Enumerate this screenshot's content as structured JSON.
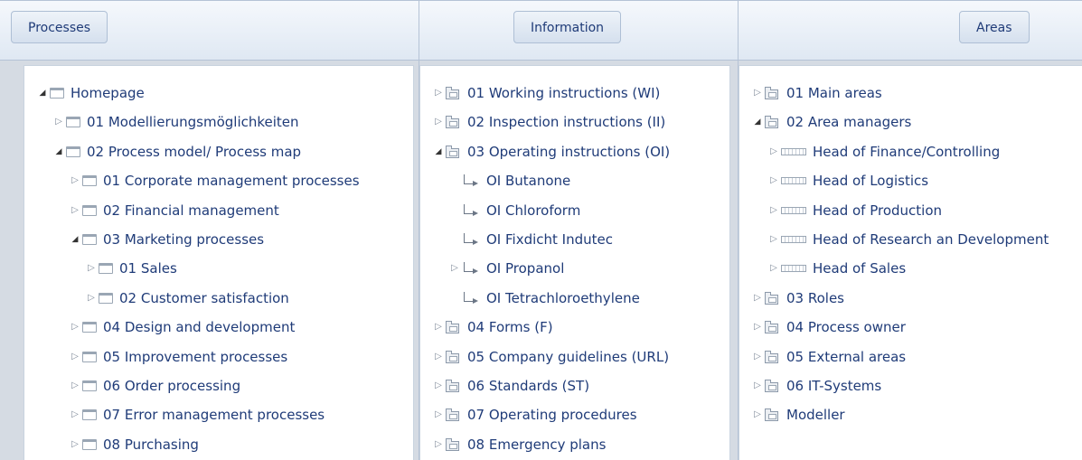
{
  "headers": {
    "processes": "Processes",
    "information": "Information",
    "areas": "Areas"
  },
  "processes_tree": [
    {
      "label": "Homepage",
      "toggle": "open",
      "level": 0
    },
    {
      "label": "01 Modellierungsmöglichkeiten",
      "toggle": "closed",
      "level": 1
    },
    {
      "label": "02 Process model/ Process map",
      "toggle": "open",
      "level": 1
    },
    {
      "label": "01 Corporate management processes",
      "toggle": "closed",
      "level": 2
    },
    {
      "label": "02 Financial management",
      "toggle": "closed",
      "level": 2
    },
    {
      "label": "03 Marketing processes",
      "toggle": "open",
      "level": 2
    },
    {
      "label": "01 Sales",
      "toggle": "closed",
      "level": 3
    },
    {
      "label": "02 Customer satisfaction",
      "toggle": "closed",
      "level": 3
    },
    {
      "label": "04 Design and development",
      "toggle": "closed",
      "level": 2
    },
    {
      "label": "05 Improvement processes",
      "toggle": "closed",
      "level": 2
    },
    {
      "label": "06 Order processing",
      "toggle": "closed",
      "level": 2
    },
    {
      "label": "07 Error management processes",
      "toggle": "closed",
      "level": 2
    },
    {
      "label": "08 Purchasing",
      "toggle": "closed",
      "level": 2
    }
  ],
  "information_tree": [
    {
      "label": "01 Working instructions (WI)",
      "toggle": "closed",
      "icon": "folder"
    },
    {
      "label": "02 Inspection instructions (II)",
      "toggle": "closed",
      "icon": "folder"
    },
    {
      "label": "03 Operating instructions (OI)",
      "toggle": "open",
      "icon": "folder"
    },
    {
      "label": "OI Butanone",
      "toggle": "none",
      "icon": "link"
    },
    {
      "label": "OI Chloroform",
      "toggle": "none",
      "icon": "link"
    },
    {
      "label": "OI Fixdicht Indutec",
      "toggle": "none",
      "icon": "link"
    },
    {
      "label": "OI Propanol",
      "toggle": "closed",
      "icon": "link"
    },
    {
      "label": "OI Tetrachloroethylene",
      "toggle": "none",
      "icon": "link"
    },
    {
      "label": "04 Forms (F)",
      "toggle": "closed",
      "icon": "folder"
    },
    {
      "label": "05 Company guidelines (URL)",
      "toggle": "closed",
      "icon": "folder"
    },
    {
      "label": "06 Standards (ST)",
      "toggle": "closed",
      "icon": "folder"
    },
    {
      "label": "07 Operating procedures",
      "toggle": "closed",
      "icon": "folder"
    },
    {
      "label": "08 Emergency plans",
      "toggle": "closed",
      "icon": "folder"
    }
  ],
  "areas_tree": [
    {
      "label": "01 Main areas",
      "toggle": "closed",
      "icon": "folder"
    },
    {
      "label": "02 Area managers",
      "toggle": "open",
      "icon": "folder"
    },
    {
      "label": "Head of Finance/Controlling",
      "toggle": "closed",
      "icon": "role"
    },
    {
      "label": "Head of Logistics",
      "toggle": "closed",
      "icon": "role"
    },
    {
      "label": "Head of Production",
      "toggle": "closed",
      "icon": "role"
    },
    {
      "label": "Head of Research an Development",
      "toggle": "closed",
      "icon": "role"
    },
    {
      "label": "Head of Sales",
      "toggle": "closed",
      "icon": "role"
    },
    {
      "label": "03 Roles",
      "toggle": "closed",
      "icon": "folder"
    },
    {
      "label": "04 Process owner",
      "toggle": "closed",
      "icon": "folder"
    },
    {
      "label": "05 External areas",
      "toggle": "closed",
      "icon": "folder"
    },
    {
      "label": "06 IT-Systems",
      "toggle": "closed",
      "icon": "folder"
    },
    {
      "label": "Modeller",
      "toggle": "closed",
      "icon": "folder"
    }
  ]
}
